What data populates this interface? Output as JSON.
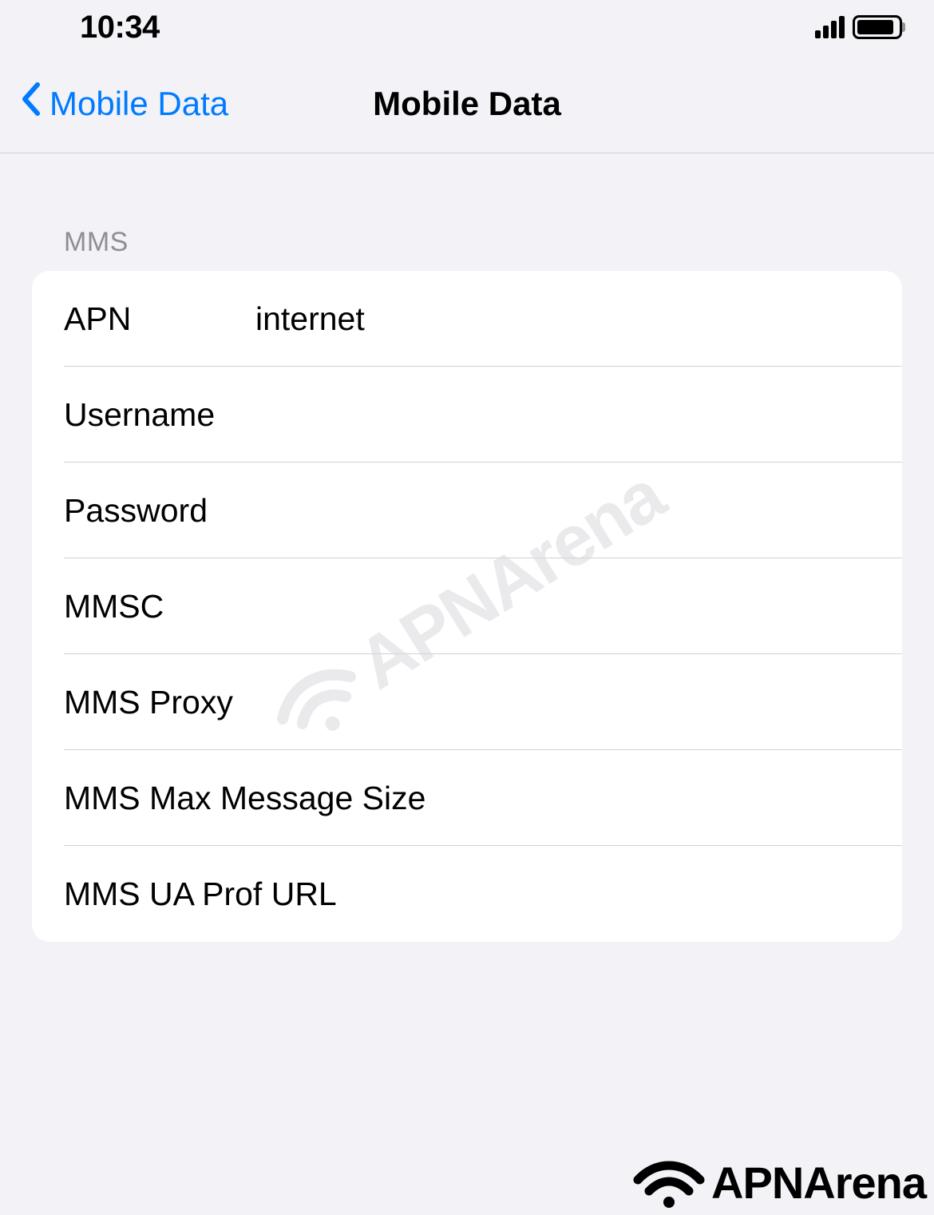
{
  "statusBar": {
    "time": "10:34"
  },
  "navBar": {
    "backLabel": "Mobile Data",
    "title": "Mobile Data"
  },
  "section": {
    "header": "MMS",
    "rows": [
      {
        "label": "APN",
        "value": "internet"
      },
      {
        "label": "Username",
        "value": ""
      },
      {
        "label": "Password",
        "value": ""
      },
      {
        "label": "MMSC",
        "value": ""
      },
      {
        "label": "MMS Proxy",
        "value": ""
      },
      {
        "label": "MMS Max Message Size",
        "value": ""
      },
      {
        "label": "MMS UA Prof URL",
        "value": ""
      }
    ]
  },
  "watermark": "APNArena",
  "branding": "APNArena"
}
